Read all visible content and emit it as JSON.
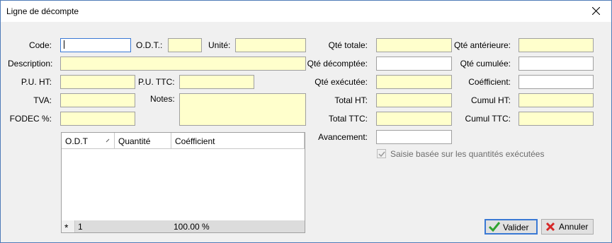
{
  "window": {
    "title": "Ligne de décompte"
  },
  "labels": {
    "code": "Code:",
    "odt": "O.D.T.:",
    "unite": "Unité:",
    "description": "Description:",
    "pu_ht": "P.U. HT:",
    "pu_ttc": "P.U. TTC:",
    "tva": "TVA:",
    "notes": "Notes:",
    "fodec": "FODEC %:",
    "qte_totale": "Qté totale:",
    "qte_decomptee": "Qté décomptée:",
    "qte_executee": "Qté exécutée:",
    "total_ht": "Total HT:",
    "total_ttc": "Total TTC:",
    "avancement": "Avancement:",
    "qte_anterieure": "Qté antérieure:",
    "qte_cumulee": "Qté cumulée:",
    "coefficient": "Coéfficient:",
    "cumul_ht": "Cumul HT:",
    "cumul_ttc": "Cumul TTC:"
  },
  "checkbox": {
    "label": "Saisie basée sur les quantités exécutées",
    "checked": true,
    "enabled": false
  },
  "grid": {
    "columns": [
      "O.D.T",
      "Quantité",
      "Coéfficient"
    ],
    "footer": {
      "marker": "*",
      "count": "1",
      "total": "100.00 %"
    }
  },
  "buttons": {
    "ok": "Valider",
    "cancel": "Annuler"
  },
  "colors": {
    "field_bg": "#ffffcc",
    "focus_border": "#3a79d4",
    "ok_icon": "#2fa32f",
    "cancel_icon": "#d62828"
  },
  "icons": {
    "ok": "checkmark-icon",
    "cancel": "x-icon",
    "close": "close-icon"
  }
}
